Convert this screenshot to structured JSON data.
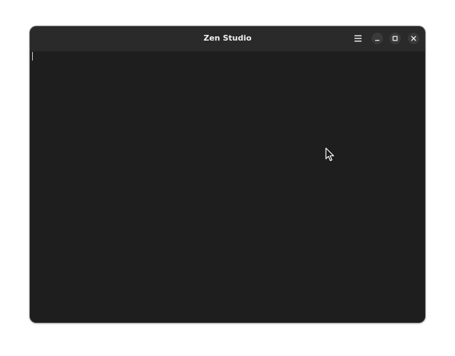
{
  "window": {
    "title": "Zen Studio"
  },
  "titlebar": {
    "icons": {
      "menu": "hamburger-menu-icon",
      "minimize": "minimize-icon",
      "maximize": "maximize-icon",
      "close": "close-icon"
    }
  },
  "editor": {
    "text": ""
  },
  "colors": {
    "window_bg": "#1e1e1e",
    "titlebar_bg": "#2a2a2a",
    "title_text": "#f2f2f2",
    "control_bg": "#3a3a3a"
  }
}
